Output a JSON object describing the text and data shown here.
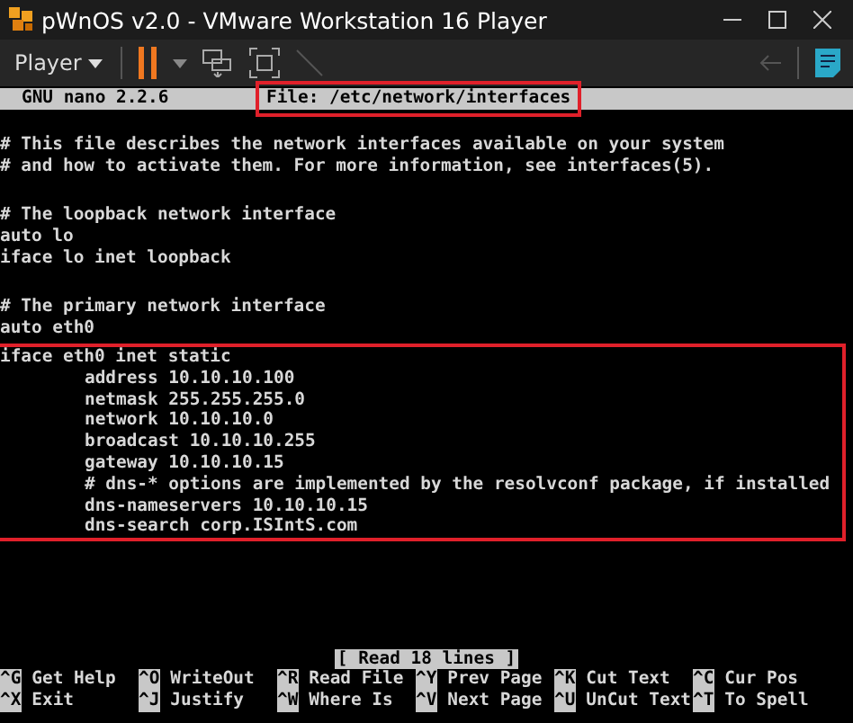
{
  "window": {
    "title": "pWnOS v2.0 - VMware Workstation 16 Player"
  },
  "toolbar": {
    "menu_label": "Player"
  },
  "nano": {
    "version": "GNU nano 2.2.6",
    "file": "File: /etc/network/interfaces",
    "file_highlighted": true
  },
  "sections": [
    {
      "blank_before": false,
      "highlighted": false,
      "lines": [
        {
          "text": "# This file describes the network interfaces available on your system",
          "indented": false
        },
        {
          "text": "# and how to activate them. For more information, see interfaces(5).",
          "indented": false
        }
      ]
    },
    {
      "blank_before": true,
      "highlighted": false,
      "lines": [
        {
          "text": "# The loopback network interface",
          "indented": false
        },
        {
          "text": "auto lo",
          "indented": false
        },
        {
          "text": "iface lo inet loopback",
          "indented": false
        }
      ]
    },
    {
      "blank_before": true,
      "highlighted": false,
      "lines": [
        {
          "text": "# The primary network interface",
          "indented": false
        },
        {
          "text": "auto eth0",
          "indented": false
        }
      ]
    },
    {
      "blank_before": false,
      "highlighted": true,
      "lines": [
        {
          "text": "iface eth0 inet static",
          "indented": false
        },
        {
          "text": "address 10.10.10.100",
          "indented": true
        },
        {
          "text": "netmask 255.255.255.0",
          "indented": true
        },
        {
          "text": "network 10.10.10.0",
          "indented": true
        },
        {
          "text": "broadcast 10.10.10.255",
          "indented": true
        },
        {
          "text": "gateway 10.10.10.15",
          "indented": true
        },
        {
          "text": "# dns-* options are implemented by the resolvconf package, if installed",
          "indented": true
        },
        {
          "text": "dns-nameservers 10.10.10.15",
          "indented": true
        },
        {
          "text": "dns-search corp.ISIntS.com",
          "indented": true
        }
      ]
    }
  ],
  "status": "[ Read 18 lines ]",
  "shortcuts": [
    [
      {
        "key": "^G",
        "label": "Get Help"
      },
      {
        "key": "^O",
        "label": "WriteOut"
      },
      {
        "key": "^R",
        "label": "Read File"
      },
      {
        "key": "^Y",
        "label": "Prev Page"
      },
      {
        "key": "^K",
        "label": "Cut Text"
      },
      {
        "key": "^C",
        "label": "Cur Pos"
      }
    ],
    [
      {
        "key": "^X",
        "label": "Exit"
      },
      {
        "key": "^J",
        "label": "Justify"
      },
      {
        "key": "^W",
        "label": "Where Is"
      },
      {
        "key": "^V",
        "label": "Next Page"
      },
      {
        "key": "^U",
        "label": "UnCut Text"
      },
      {
        "key": "^T",
        "label": "To Spell"
      }
    ]
  ]
}
